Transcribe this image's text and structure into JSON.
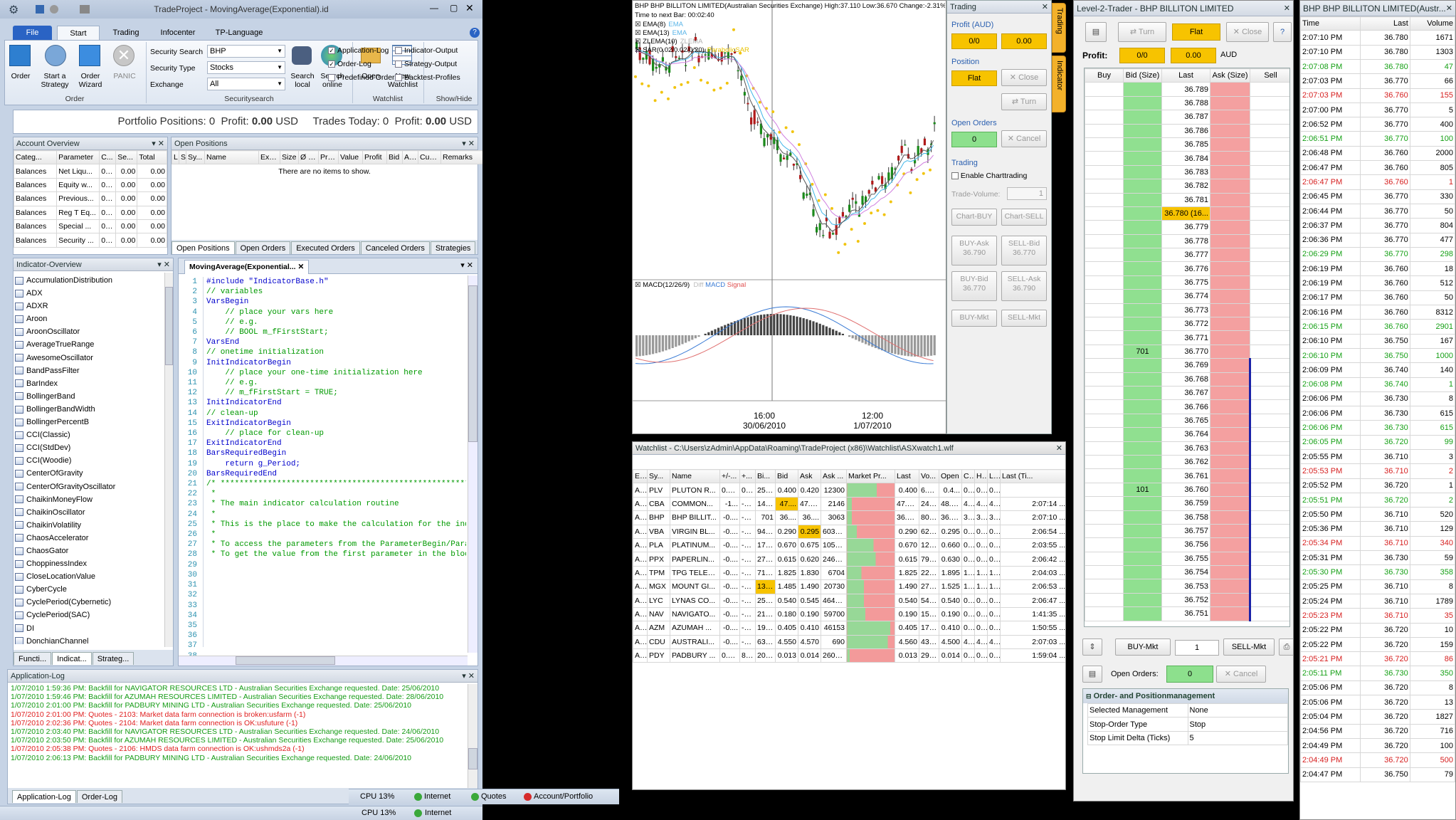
{
  "app": {
    "title": "TradeProject - MovingAverage(Exponential).id",
    "menu_tabs": [
      "File",
      "Start",
      "Trading",
      "Infocenter",
      "TP-Language"
    ]
  },
  "ribbon": {
    "order_group": {
      "label": "Order",
      "buttons": [
        "Order",
        "Start a Strategy",
        "Order Wizard",
        "PANIC"
      ]
    },
    "security": {
      "label": "Securitysearch",
      "search_label": "Security Search",
      "search_value": "BHP",
      "type_label": "Security Type",
      "type_value": "Stocks",
      "exchange_label": "Exchange",
      "exchange_value": "All",
      "btn_local": "Search local",
      "btn_online": "Search online"
    },
    "watchlist": {
      "label": "Watchlist",
      "open": "Open",
      "new": "New Watchlist"
    },
    "showhide": {
      "label": "Show/Hide",
      "items": [
        {
          "t": "Application-Log",
          "c": true
        },
        {
          "t": "Indicator-Output",
          "c": false
        },
        {
          "t": "Order-Log",
          "c": true
        },
        {
          "t": "Strategy-Output",
          "c": false
        },
        {
          "t": "Predefined Orders",
          "c": false
        },
        {
          "t": "Backtest-Profiles",
          "c": false
        }
      ]
    }
  },
  "portfolio_bar": {
    "positions_label": "Portfolio Positions:",
    "positions": "0",
    "profit_label": "Profit:",
    "profit": "0.00",
    "ccy": "USD",
    "trades_label": "Trades Today:",
    "trades": "0",
    "profit2_label": "Profit:",
    "profit2": "0.00",
    "ccy2": "USD"
  },
  "account": {
    "title": "Account Overview",
    "cols": [
      "Categ...",
      "Parameter",
      "C...",
      "Se...",
      "Total"
    ],
    "rows": [
      [
        "Balances",
        "Net Liqu...",
        "0.00",
        "0.00",
        "0.00"
      ],
      [
        "Balances",
        "Equity w...",
        "0.00",
        "0.00",
        "0.00"
      ],
      [
        "Balances",
        "Previous...",
        "0.00",
        "0.00",
        "0.00"
      ],
      [
        "Balances",
        "Reg T Eq...",
        "0.00",
        "0.00",
        "0.00"
      ],
      [
        "Balances",
        "Special ...",
        "0.00",
        "0.00",
        "0.00"
      ],
      [
        "Balances",
        "Security ...",
        "0.00",
        "0.00",
        "0.00"
      ]
    ]
  },
  "positions": {
    "title": "Open Positions",
    "cols": [
      "L",
      "S",
      "Sy...",
      "Name",
      "Exc...",
      "Size",
      "Ø Pr...",
      "Price",
      "Value",
      "Profit",
      "Bid",
      "Ask",
      "Curr...",
      "Remarks",
      "Order Source"
    ],
    "empty": "There are no items to show.",
    "tabs": [
      "Open Positions",
      "Open Orders",
      "Executed Orders",
      "Canceled Orders",
      "Strategies"
    ]
  },
  "indicators": {
    "title": "Indicator-Overview",
    "items": [
      "AccumulationDistribution",
      "ADX",
      "ADXR",
      "Aroon",
      "AroonOscillator",
      "AverageTrueRange",
      "AwesomeOscillator",
      "BandPassFilter",
      "BarIndex",
      "BollingerBand",
      "BollingerBandWidth",
      "BollingerPercentB",
      "CCI(Classic)",
      "CCI(StdDev)",
      "CCI(Woodie)",
      "CenterOfGravity",
      "CenterOfGravityOscillator",
      "ChaikinMoneyFlow",
      "ChaikinOscillator",
      "ChaikinVolatility",
      "ChaosAccelerator",
      "ChaosGator",
      "ChoppinessIndex",
      "CloseLocationValue",
      "CyberCycle",
      "CyclePeriod(Cybernetic)",
      "CyclePeriod(SAC)",
      "DI",
      "DonchianChannel"
    ],
    "tabs": [
      "Functi...",
      "Indicat...",
      "Strateg..."
    ]
  },
  "editor": {
    "tab": "MovingAverage(Exponential...",
    "lines": [
      [
        "k",
        "#include \"IndicatorBase.h\""
      ],
      [
        "n",
        ""
      ],
      [
        "n",
        ""
      ],
      [
        "c",
        "// variables"
      ],
      [
        "k",
        "VarsBegin"
      ],
      [
        "c",
        "    // place your vars here"
      ],
      [
        "c",
        "    // e.g."
      ],
      [
        "c",
        "    // BOOL m_fFirstStart;"
      ],
      [
        "k",
        "VarsEnd"
      ],
      [
        "n",
        ""
      ],
      [
        "n",
        ""
      ],
      [
        "c",
        "// onetime initialization"
      ],
      [
        "k",
        "InitIndicatorBegin"
      ],
      [
        "c",
        "    // place your one-time initialization here"
      ],
      [
        "c",
        "    // e.g."
      ],
      [
        "c",
        "    // m_fFirstStart = TRUE;"
      ],
      [
        "k",
        "InitIndicatorEnd"
      ],
      [
        "n",
        ""
      ],
      [
        "n",
        ""
      ],
      [
        "c",
        "// clean-up"
      ],
      [
        "k",
        "ExitIndicatorBegin"
      ],
      [
        "c",
        "    // place for clean-up"
      ],
      [
        "k",
        "ExitIndicatorEnd"
      ],
      [
        "n",
        ""
      ],
      [
        "n",
        ""
      ],
      [
        "k",
        "BarsRequiredBegin"
      ],
      [
        "k",
        "    return g_Period;"
      ],
      [
        "k",
        "BarsRequiredEnd"
      ],
      [
        "n",
        ""
      ],
      [
        "n",
        ""
      ],
      [
        "c",
        "/* ********************************************************************"
      ],
      [
        "c",
        " *"
      ],
      [
        "c",
        " * The main indicator calculation routine"
      ],
      [
        "c",
        " *"
      ],
      [
        "c",
        " * This is the place to make the calculation for the indicator."
      ],
      [
        "c",
        " *"
      ],
      [
        "c",
        " * To access the parameters from the ParameterBegin/ParameterEnd block use func"
      ],
      [
        "c",
        " * To get the value from the first parameter in the block call GetParameterVal:"
      ]
    ]
  },
  "applog": {
    "title": "Application-Log",
    "lines": [
      [
        "g",
        "1/07/2010 1:59:36 PM: Backfill for NAVIGATOR RESOURCES LTD - Australian Securities Exchange requested. Date: 25/06/2010"
      ],
      [
        "g",
        "1/07/2010 1:59:46 PM: Backfill for AZUMAH RESOURCES LIMITED - Australian Securities Exchange requested. Date: 28/06/2010"
      ],
      [
        "g",
        "1/07/2010 2:01:00 PM: Backfill for PADBURY MINING LTD - Australian Securities Exchange requested. Date: 25/06/2010"
      ],
      [
        "r",
        "1/07/2010 2:01:00 PM: Quotes - 2103: Market data farm connection is broken:usfarm (-1)"
      ],
      [
        "r",
        "1/07/2010 2:02:36 PM: Quotes - 2104: Market data farm connection is OK:usfuture (-1)"
      ],
      [
        "g",
        "1/07/2010 2:03:40 PM: Backfill for NAVIGATOR RESOURCES LTD - Australian Securities Exchange requested. Date: 24/06/2010"
      ],
      [
        "g",
        "1/07/2010 2:03:50 PM: Backfill for AZUMAH RESOURCES LIMITED - Australian Securities Exchange requested. Date: 25/06/2010"
      ],
      [
        "r",
        "1/07/2010 2:05:38 PM: Quotes - 2106: HMDS data farm connection is OK:ushmds2a (-1)"
      ],
      [
        "g",
        "1/07/2010 2:06:13 PM: Backfill for PADBURY MINING LTD - Australian Securities Exchange requested. Date: 24/06/2010"
      ]
    ],
    "tabs": [
      "Application-Log",
      "Order-Log"
    ]
  },
  "status": {
    "cpu": "CPU 13%",
    "internet": "Internet",
    "quotes": "Quotes",
    "account": "Account/Portfolio"
  },
  "chart": {
    "title": "BHP BHP BILLITON LIMITED(Australian Securities Exchange) High:37.110 Low:36.670 Change:-2.31%",
    "next_bar": "Time to next Bar: 00:02:40",
    "legend": [
      "EMA(8)",
      "EMA(13)",
      "ZLEMA(10)",
      "SAR(0.02/0.02/0.20)"
    ],
    "legend_tags": [
      "EMA",
      "EMA",
      "ZLEMA",
      "ParabolicSAR"
    ],
    "macd": "MACD(12/26/9)",
    "macd_tags": [
      "Diff",
      "MACD",
      "Signal"
    ],
    "x_labels": [
      {
        "t": "16:00",
        "d": "30/06/2010"
      },
      {
        "t": "12:00",
        "d": "1/07/2010"
      }
    ]
  },
  "trading_panel": {
    "title": "Trading",
    "profit_label": "Profit (AUD)",
    "profit_left": "0/0",
    "profit_right": "0.00",
    "position_label": "Position",
    "position_value": "Flat",
    "close": "Close",
    "turn": "Turn",
    "orders_label": "Open Orders",
    "orders_value": "0",
    "cancel": "Cancel",
    "trading_label": "Trading",
    "enable": "Enable Charttrading",
    "volume_label": "Trade-Volume:",
    "volume": "1",
    "btns": [
      "Chart-BUY",
      "Chart-SELL",
      "BUY-Ask 36.790",
      "SELL-Bid 36.770",
      "BUY-Bid 36.770",
      "SELL-Ask 36.790",
      "BUY-Mkt",
      "SELL-Mkt"
    ],
    "side_tabs": [
      "Trading",
      "Indicator"
    ]
  },
  "watchlist": {
    "title": "Watchlist - C:\\Users\\zAdmin\\AppData\\Roaming\\TradeProject (x86)\\Watchlist\\ASXwatch1.wlf",
    "cols": [
      "E...",
      "Sy...",
      "Name",
      "+/-...",
      "+...",
      "Bi...",
      "Bid",
      "Ask",
      "Ask ...",
      "Market Pr...",
      "Last",
      "Vo...",
      "Open",
      "C...",
      "H...",
      "L...",
      "Last (Ti..."
    ],
    "rows": [
      [
        "A...",
        "PLV",
        "PLUTON R...",
        "0.0...",
        "0....",
        "250...",
        "0.400",
        "0.420",
        "12300",
        0.62,
        "0.400",
        "6.0...",
        "0.4...",
        "0....",
        "0....",
        "0....",
        ""
      ],
      [
        "A...",
        "CBA",
        "COMMON...",
        "-1...",
        "-3...",
        "146...",
        "47....",
        "47.580",
        "2146",
        0.1,
        "47.520",
        "240...",
        "48.2...",
        "4....",
        "4....",
        "4....",
        "2:07:14 ..."
      ],
      [
        "A...",
        "BHP",
        "BHP BILLIT...",
        "-0....",
        "-2....",
        "701",
        "36....",
        "36....",
        "3063",
        0.1,
        "36.780",
        "802...",
        "36.9...",
        "3....",
        "3....",
        "3....",
        "2:07:10 ..."
      ],
      [
        "A...",
        "VBA",
        "VIRGIN BL...",
        "-0....",
        "-1....",
        "946...",
        "0.290",
        "0.295",
        "6038...",
        0.2,
        "0.290",
        "624...",
        "0.295",
        "0....",
        "0....",
        "0....",
        "2:06:54 ..."
      ],
      [
        "A...",
        "PLA",
        "PLATINUM...",
        "-0....",
        "-1....",
        "170...",
        "0.670",
        "0.675",
        "1054...",
        0.55,
        "0.670",
        "123...",
        "0.660",
        "0....",
        "0....",
        "0....",
        "2:03:55 ..."
      ],
      [
        "A...",
        "PPX",
        "PAPERLIN...",
        "-0....",
        "-2....",
        "277...",
        "0.615",
        "0.620",
        "2460...",
        0.6,
        "0.615",
        "793...",
        "0.630",
        "0....",
        "0....",
        "0....",
        "2:06:42 ..."
      ],
      [
        "A...",
        "TPM",
        "TPG TELEC...",
        "-0....",
        "-4....",
        "7137",
        "1.825",
        "1.830",
        "6704",
        0.3,
        "1.825",
        "226...",
        "1.895",
        "1....",
        "1....",
        "1....",
        "2:04:03 ..."
      ],
      [
        "A...",
        "MGX",
        "MOUNT GI...",
        "-0....",
        "-3....",
        "132...",
        "1.485",
        "1.490",
        "20730",
        0.35,
        "1.490",
        "277...",
        "1.525",
        "1....",
        "1....",
        "1....",
        "2:06:53 ..."
      ],
      [
        "A...",
        "LYC",
        "LYNAS CO...",
        "-0....",
        "-1....",
        "254...",
        "0.540",
        "0.545",
        "4642...",
        0.35,
        "0.540",
        "542...",
        "0.540",
        "0....",
        "0....",
        "0....",
        "2:06:47 ..."
      ],
      [
        "A...",
        "NAV",
        "NAVIGATO...",
        "-0....",
        "-1....",
        "218...",
        "0.180",
        "0.190",
        "59700",
        0.38,
        "0.190",
        "159...",
        "0.190",
        "0....",
        "0....",
        "0....",
        "1:41:35 ..."
      ],
      [
        "A...",
        "AZM",
        "AZUMAH ...",
        "-0....",
        "-1....",
        "1962",
        "0.405",
        "0.410",
        "46153",
        0.9,
        "0.405",
        "173...",
        "0.410",
        "0....",
        "0....",
        "0....",
        "1:50:55 ..."
      ],
      [
        "A...",
        "CDU",
        "AUSTRALI...",
        "-0....",
        "-2....",
        "6370",
        "4.550",
        "4.570",
        "690",
        0.85,
        "4.560",
        "434...",
        "4.500",
        "4....",
        "4....",
        "4....",
        "2:07:03 ..."
      ],
      [
        "A...",
        "PDY",
        "PADBURY ...",
        "0.0...",
        "8....",
        "209...",
        "0.013",
        "0.014",
        "2600...",
        0.05,
        "0.013",
        "295...",
        "0.014",
        "0....",
        "0....",
        "0....",
        "1:59:04 ..."
      ]
    ],
    "highlights": [
      [
        1,
        6
      ],
      [
        7,
        5
      ],
      [
        3,
        7
      ]
    ]
  },
  "l2": {
    "title": "Level-2-Trader - BHP BILLITON LIMITED",
    "turn": "Turn",
    "flat": "Flat",
    "close": "Close",
    "profit_label": "Profit:",
    "profit_left": "0/0",
    "profit_right": "0.00",
    "ccy": "AUD",
    "cols": [
      "Buy",
      "Bid (Size)",
      "Last",
      "Ask (Size)",
      "Sell"
    ],
    "prices": [
      "36.789",
      "36.788",
      "36.787",
      "36.786",
      "36.785",
      "36.784",
      "36.783",
      "36.782",
      "36.781",
      "36.780 (16...",
      "36.779",
      "36.778",
      "36.777",
      "36.776",
      "36.775",
      "36.774",
      "36.773",
      "36.772",
      "36.771",
      "36.770",
      "36.769",
      "36.768",
      "36.767",
      "36.766",
      "36.765",
      "36.764",
      "36.763",
      "36.762",
      "36.761",
      "36.760",
      "36.759",
      "36.758",
      "36.757",
      "36.756",
      "36.755",
      "36.754",
      "36.753",
      "36.752",
      "36.751"
    ],
    "bid_sizes": {
      "19": "701",
      "29": "101"
    },
    "ask_marker_from": 20,
    "buy_mkt": "BUY-Mkt",
    "qty": "1",
    "sell_mkt": "SELL-Mkt",
    "open_orders_label": "Open Orders:",
    "open_orders": "0",
    "cancel": "Cancel",
    "mgmt_title": "Order- and Positionmanagement",
    "mgmt": [
      [
        "Selected Management",
        "None"
      ],
      [
        "Stop-Order Type",
        "Stop"
      ],
      [
        "Stop Limit Delta (Ticks)",
        "5"
      ]
    ]
  },
  "ts": {
    "title": "BHP BHP BILLITON LIMITED(Austr...",
    "cols": [
      "Time",
      "Last",
      "Volume"
    ],
    "rows": [
      [
        "2:07:10 PM",
        "36.780",
        "1671",
        "n"
      ],
      [
        "2:07:10 PM",
        "36.780",
        "1303",
        "n"
      ],
      [
        "2:07:08 PM",
        "36.780",
        "47",
        "g"
      ],
      [
        "2:07:03 PM",
        "36.770",
        "66",
        "n"
      ],
      [
        "2:07:03 PM",
        "36.760",
        "155",
        "r"
      ],
      [
        "2:07:00 PM",
        "36.770",
        "5",
        "n"
      ],
      [
        "2:06:52 PM",
        "36.770",
        "400",
        "n"
      ],
      [
        "2:06:51 PM",
        "36.770",
        "100",
        "g"
      ],
      [
        "2:06:48 PM",
        "36.760",
        "2000",
        "n"
      ],
      [
        "2:06:47 PM",
        "36.760",
        "805",
        "n"
      ],
      [
        "2:06:47 PM",
        "36.760",
        "1",
        "r"
      ],
      [
        "2:06:45 PM",
        "36.770",
        "330",
        "n"
      ],
      [
        "2:06:44 PM",
        "36.770",
        "50",
        "n"
      ],
      [
        "2:06:37 PM",
        "36.770",
        "804",
        "n"
      ],
      [
        "2:06:36 PM",
        "36.770",
        "477",
        "n"
      ],
      [
        "2:06:29 PM",
        "36.770",
        "298",
        "g"
      ],
      [
        "2:06:19 PM",
        "36.760",
        "18",
        "n"
      ],
      [
        "2:06:19 PM",
        "36.760",
        "512",
        "n"
      ],
      [
        "2:06:17 PM",
        "36.760",
        "50",
        "n"
      ],
      [
        "2:06:16 PM",
        "36.760",
        "8312",
        "n"
      ],
      [
        "2:06:15 PM",
        "36.760",
        "2901",
        "g"
      ],
      [
        "2:06:10 PM",
        "36.750",
        "167",
        "n"
      ],
      [
        "2:06:10 PM",
        "36.750",
        "1000",
        "g"
      ],
      [
        "2:06:09 PM",
        "36.740",
        "140",
        "n"
      ],
      [
        "2:06:08 PM",
        "36.740",
        "1",
        "g"
      ],
      [
        "2:06:06 PM",
        "36.730",
        "8",
        "n"
      ],
      [
        "2:06:06 PM",
        "36.730",
        "615",
        "n"
      ],
      [
        "2:06:06 PM",
        "36.730",
        "615",
        "g"
      ],
      [
        "2:06:05 PM",
        "36.720",
        "99",
        "g"
      ],
      [
        "2:05:55 PM",
        "36.710",
        "3",
        "n"
      ],
      [
        "2:05:53 PM",
        "36.710",
        "2",
        "r"
      ],
      [
        "2:05:52 PM",
        "36.720",
        "1",
        "n"
      ],
      [
        "2:05:51 PM",
        "36.720",
        "2",
        "g"
      ],
      [
        "2:05:50 PM",
        "36.710",
        "520",
        "n"
      ],
      [
        "2:05:36 PM",
        "36.710",
        "129",
        "n"
      ],
      [
        "2:05:34 PM",
        "36.710",
        "340",
        "r"
      ],
      [
        "2:05:31 PM",
        "36.730",
        "59",
        "n"
      ],
      [
        "2:05:30 PM",
        "36.730",
        "358",
        "g"
      ],
      [
        "2:05:25 PM",
        "36.710",
        "8",
        "n"
      ],
      [
        "2:05:24 PM",
        "36.710",
        "1789",
        "n"
      ],
      [
        "2:05:23 PM",
        "36.710",
        "35",
        "r"
      ],
      [
        "2:05:22 PM",
        "36.720",
        "10",
        "n"
      ],
      [
        "2:05:22 PM",
        "36.720",
        "159",
        "n"
      ],
      [
        "2:05:21 PM",
        "36.720",
        "86",
        "r"
      ],
      [
        "2:05:11 PM",
        "36.730",
        "350",
        "g"
      ],
      [
        "2:05:06 PM",
        "36.720",
        "8",
        "n"
      ],
      [
        "2:05:06 PM",
        "36.720",
        "13",
        "n"
      ],
      [
        "2:05:04 PM",
        "36.720",
        "1827",
        "n"
      ],
      [
        "2:04:56 PM",
        "36.720",
        "716",
        "n"
      ],
      [
        "2:04:49 PM",
        "36.720",
        "100",
        "n"
      ],
      [
        "2:04:49 PM",
        "36.720",
        "500",
        "r"
      ],
      [
        "2:04:47 PM",
        "36.750",
        "79",
        "n"
      ]
    ]
  }
}
